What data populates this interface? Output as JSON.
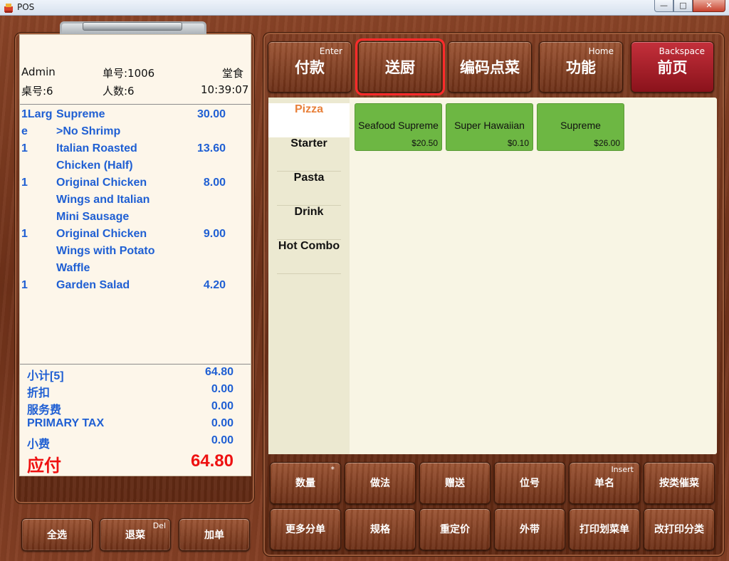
{
  "window": {
    "title": "POS",
    "min": "—",
    "max": "□",
    "close": "✕"
  },
  "order": {
    "user": "Admin",
    "order_no": "单号:1006",
    "dine_type": "堂食",
    "table": "桌号:6",
    "guests": "人数:6",
    "time": "10:39:07"
  },
  "items": [
    {
      "qty": "1Larg\ne",
      "name": "Supreme\n>No Shrimp",
      "price": "30.00"
    },
    {
      "qty": "1",
      "name": "Italian Roasted\nChicken (Half)",
      "price": "13.60"
    },
    {
      "qty": "1",
      "name": "Original Chicken\nWings and Italian\nMini Sausage",
      "price": "8.00"
    },
    {
      "qty": "1",
      "name": "Original Chicken\nWings with Potato\nWaffle",
      "price": "9.00"
    },
    {
      "qty": "1",
      "name": "Garden Salad",
      "price": "4.20"
    }
  ],
  "totals": {
    "subtotal_label": "小计[5]",
    "subtotal": "64.80",
    "discount_label": "折扣",
    "discount": "0.00",
    "service_label": "服务费",
    "service": "0.00",
    "tax_label": "PRIMARY TAX",
    "tax": "0.00",
    "tip_label": "小费",
    "tip": "0.00",
    "due_label": "应付",
    "due": "64.80"
  },
  "left_buttons": {
    "select_all": "全选",
    "return": "退菜",
    "return_key": "Del",
    "add_order": "加单"
  },
  "top_buttons": {
    "pay": "付款",
    "pay_key": "Enter",
    "send_kitchen": "送厨",
    "code_order": "编码点菜",
    "functions": "功能",
    "functions_key": "Home",
    "home": "前页",
    "home_key": "Backspace"
  },
  "categories": [
    "Pizza",
    "Starter",
    "Pasta",
    "Drink",
    "Hot Combo"
  ],
  "active_category": "Pizza",
  "products": [
    {
      "name": "Seafood Supreme",
      "price": "$20.50"
    },
    {
      "name": "Super Hawaiian",
      "price": "$0.10"
    },
    {
      "name": "Supreme",
      "price": "$26.00"
    }
  ],
  "actions": {
    "quantity": "数量",
    "quantity_key": "*",
    "method": "做法",
    "gift": "赠送",
    "seat": "位号",
    "item_name": "单名",
    "item_name_key": "Insert",
    "rush_by_category": "按类催菜",
    "more_split": "更多分单",
    "spec": "规格",
    "reprice": "重定价",
    "takeout": "外带",
    "print_menu": "打印划菜单",
    "change_print_cat": "改打印分类"
  },
  "colors": {
    "accent": "#e8803a",
    "item_text": "#1f5fd3",
    "due": "#ee1111",
    "product": "#6db743",
    "highlight": "#ff2a2a"
  }
}
